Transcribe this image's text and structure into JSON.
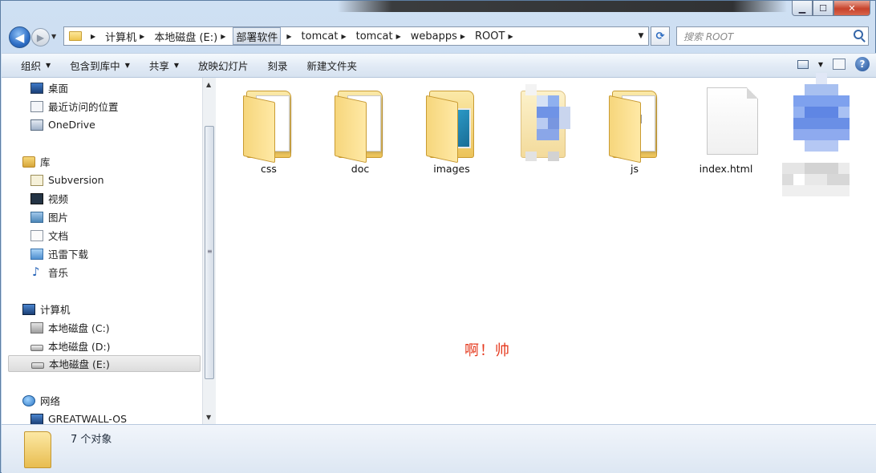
{
  "window": {
    "controls": {
      "minimize": "▁",
      "maximize": "☐",
      "close": "✕"
    }
  },
  "address_bar": {
    "breadcrumbs": [
      "计算机",
      "本地磁盘 (E:)",
      "部署软件",
      "tomcat",
      "tomcat",
      "webapps",
      "ROOT"
    ],
    "active_crumb": "部署软件",
    "refresh_icon": "refresh-icon",
    "search_placeholder": "搜索 ROOT"
  },
  "toolbar": {
    "organize": "组织",
    "include_in_library": "包含到库中",
    "share": "共享",
    "slideshow": "放映幻灯片",
    "burn": "刻录",
    "new_folder": "新建文件夹"
  },
  "sidebar": {
    "favorites": [
      {
        "label": "桌面",
        "icon": "desktop-icon"
      },
      {
        "label": "最近访问的位置",
        "icon": "recent-places-icon"
      },
      {
        "label": "OneDrive",
        "icon": "onedrive-icon"
      }
    ],
    "libraries_header": "库",
    "libraries": [
      {
        "label": "Subversion",
        "icon": "subversion-icon"
      },
      {
        "label": "视频",
        "icon": "video-icon"
      },
      {
        "label": "图片",
        "icon": "pictures-icon"
      },
      {
        "label": "文档",
        "icon": "documents-icon"
      },
      {
        "label": "迅雷下载",
        "icon": "thunder-download-icon"
      },
      {
        "label": "音乐",
        "icon": "music-icon"
      }
    ],
    "computer_header": "计算机",
    "drives": [
      {
        "label": "本地磁盘 (C:)",
        "icon": "system-drive-icon"
      },
      {
        "label": "本地磁盘 (D:)",
        "icon": "drive-icon"
      },
      {
        "label": "本地磁盘 (E:)",
        "icon": "drive-icon",
        "selected": true
      }
    ],
    "network_header": "网络",
    "network_items": [
      {
        "label": "GREATWALL-OS",
        "icon": "computer-icon"
      }
    ]
  },
  "files": [
    {
      "name": "css",
      "type": "folder"
    },
    {
      "name": "doc",
      "type": "folder"
    },
    {
      "name": "images",
      "type": "folder"
    },
    {
      "name": "",
      "type": "folder-obscured"
    },
    {
      "name": "js",
      "type": "folder"
    },
    {
      "name": "index.html",
      "type": "file"
    },
    {
      "name": "",
      "type": "obscured"
    }
  ],
  "center_text": "啊！帅",
  "details": {
    "item_count": "7 个对象"
  },
  "colors": {
    "accent_red": "#e53a1f",
    "folder_yellow": "#ecc35a",
    "frame_blue": "#c9d9ec"
  }
}
